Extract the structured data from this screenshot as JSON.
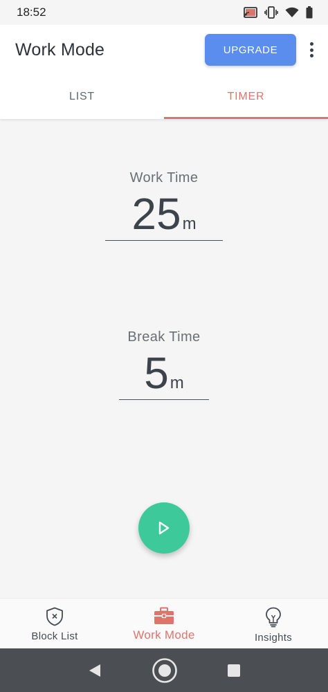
{
  "status_bar": {
    "time": "18:52",
    "icons": [
      "cast-icon",
      "vibrate-icon",
      "wifi-icon",
      "battery-icon"
    ]
  },
  "app_bar": {
    "title": "Work Mode",
    "upgrade_label": "UPGRADE",
    "more_icon": "more-vert-icon"
  },
  "tabs": [
    {
      "label": "LIST",
      "active": false
    },
    {
      "label": "TIMER",
      "active": true
    }
  ],
  "work_time": {
    "label": "Work Time",
    "value": "25",
    "unit": "m"
  },
  "break_time": {
    "label": "Break Time",
    "value": "5",
    "unit": "m"
  },
  "play_button": {
    "icon": "play-icon"
  },
  "bottom_nav": [
    {
      "label": "Block List",
      "icon": "shield-x-icon",
      "active": false
    },
    {
      "label": "Work Mode",
      "icon": "briefcase-icon",
      "active": true
    },
    {
      "label": "Insights",
      "icon": "lightbulb-icon",
      "active": false
    }
  ],
  "colors": {
    "accent": "#e0736b",
    "upgrade": "#5b8dee",
    "play": "#3ec99a",
    "background": "#f5f5f5"
  }
}
